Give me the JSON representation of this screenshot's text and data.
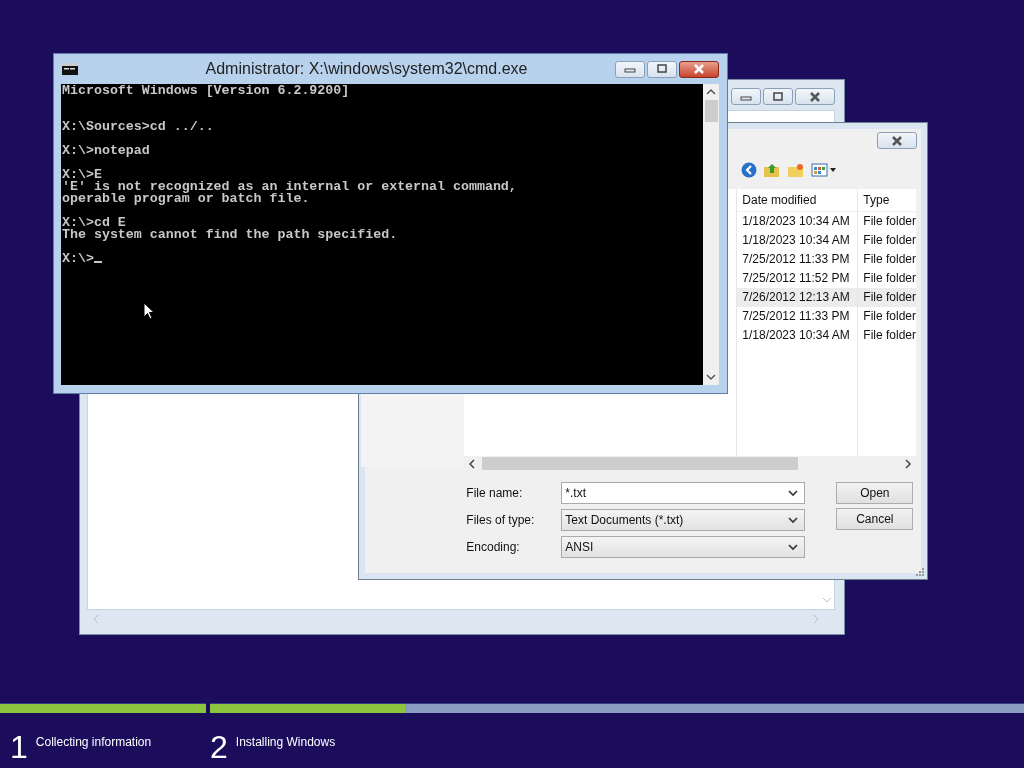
{
  "notepad_window": {
    "kind": "window"
  },
  "open_dialog": {
    "columns": [
      "Date modified",
      "Type"
    ],
    "rows": [
      {
        "date": "1/18/2023 10:34 AM",
        "type": "File folder",
        "selected": false
      },
      {
        "date": "1/18/2023 10:34 AM",
        "type": "File folder",
        "selected": false
      },
      {
        "date": "7/25/2012 11:33 PM",
        "type": "File folder",
        "selected": false
      },
      {
        "date": "7/25/2012 11:52 PM",
        "type": "File folder",
        "selected": false
      },
      {
        "date": "7/26/2012 12:13 AM",
        "type": "File folder",
        "selected": true
      },
      {
        "date": "7/25/2012 11:33 PM",
        "type": "File folder",
        "selected": false
      },
      {
        "date": "1/18/2023 10:34 AM",
        "type": "File folder",
        "selected": false
      }
    ],
    "fields": [
      {
        "label": "File name:",
        "value": "*.txt",
        "kind": "editable"
      },
      {
        "label": "Files of type:",
        "value": "Text Documents (*.txt)",
        "kind": "dropdown"
      },
      {
        "label": "Encoding:",
        "value": "ANSI",
        "kind": "dropdown"
      }
    ],
    "buttons": [
      "Open",
      "Cancel"
    ]
  },
  "cmd_window": {
    "title": "Administrator: X:\\windows\\system32\\cmd.exe",
    "blocks": [
      [
        "Microsoft Windows [Version 6.2.9200]"
      ],
      [
        "X:\\Sources>cd ../.."
      ],
      [
        "X:\\>notepad"
      ],
      [
        "X:\\>E",
        "'E' is not recognized as an internal or external command,",
        "operable program or batch file."
      ],
      [
        "X:\\>cd E",
        "The system cannot find the path specified."
      ],
      [
        "X:\\>"
      ]
    ],
    "cursor_visible": true
  },
  "setup_steps": [
    {
      "number": "1",
      "label": "Collecting information",
      "level": 1
    },
    {
      "number": "2",
      "label": "Installing Windows",
      "level": 0.24
    }
  ]
}
